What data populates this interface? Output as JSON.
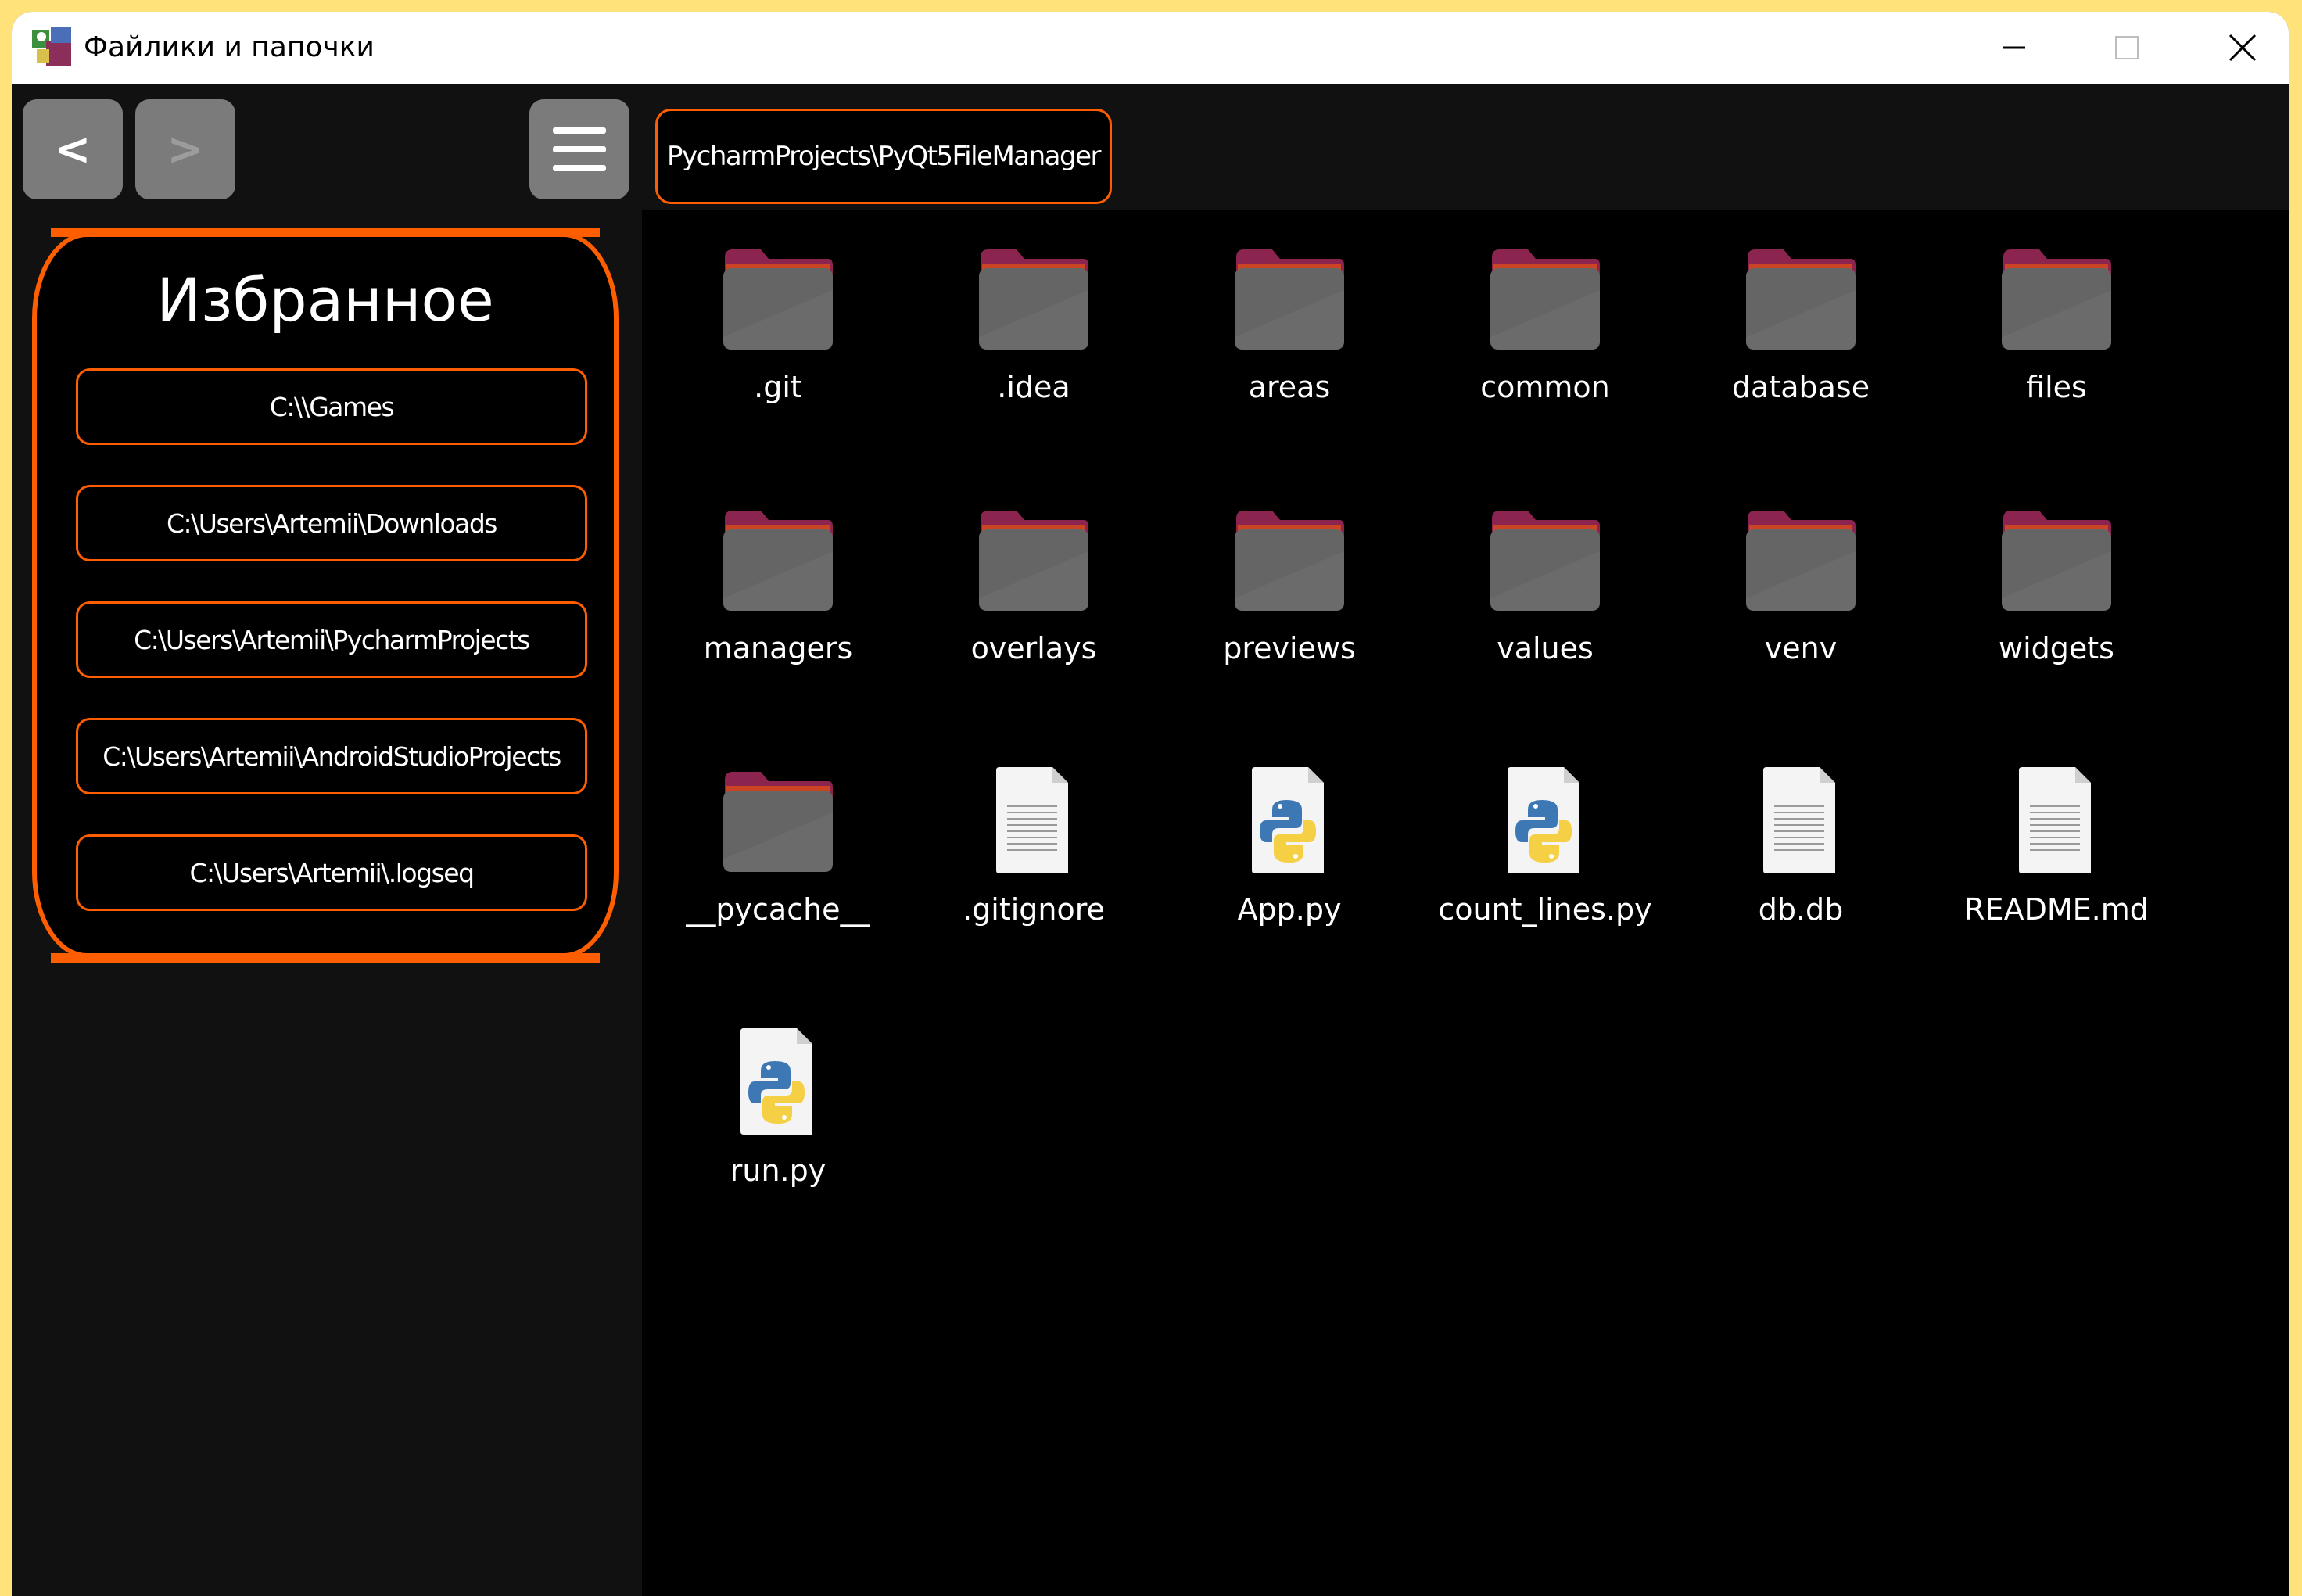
{
  "window": {
    "title": "Файлики и папочки",
    "icons": [
      "app-icon",
      "minimize-icon",
      "maximize-icon",
      "close-icon"
    ]
  },
  "toolbar": {
    "back_label": "<",
    "forward_label": ">",
    "menu_icon": "hamburger-menu-icon",
    "path": "PycharmProjects\\PyQt5FileManager"
  },
  "favorites": {
    "title": "Избранное",
    "items": [
      {
        "label": "C:\\\\Games"
      },
      {
        "label": "C:\\Users\\Artemii\\Downloads"
      },
      {
        "label": "C:\\Users\\Artemii\\PycharmProjects"
      },
      {
        "label": "C:\\Users\\Artemii\\AndroidStudioProjects"
      },
      {
        "label": "C:\\Users\\Artemii\\.logseq"
      }
    ]
  },
  "files": [
    {
      "name": ".git",
      "type": "folder"
    },
    {
      "name": ".idea",
      "type": "folder"
    },
    {
      "name": "areas",
      "type": "folder"
    },
    {
      "name": "common",
      "type": "folder"
    },
    {
      "name": "database",
      "type": "folder"
    },
    {
      "name": "files",
      "type": "folder"
    },
    {
      "name": "managers",
      "type": "folder"
    },
    {
      "name": "overlays",
      "type": "folder"
    },
    {
      "name": "previews",
      "type": "folder"
    },
    {
      "name": "values",
      "type": "folder"
    },
    {
      "name": "venv",
      "type": "folder"
    },
    {
      "name": "widgets",
      "type": "folder"
    },
    {
      "name": "__pycache__",
      "type": "folder"
    },
    {
      "name": ".gitignore",
      "type": "text"
    },
    {
      "name": "App.py",
      "type": "python"
    },
    {
      "name": "count_lines.py",
      "type": "python"
    },
    {
      "name": "db.db",
      "type": "text"
    },
    {
      "name": "README.md",
      "type": "text"
    },
    {
      "name": "run.py",
      "type": "python"
    }
  ],
  "colors": {
    "accent": "#ff5e00",
    "folder_body": "#656565",
    "folder_tab": "#8c2450",
    "background": "#000000",
    "panel": "#111111",
    "frame": "#ffe27a"
  }
}
